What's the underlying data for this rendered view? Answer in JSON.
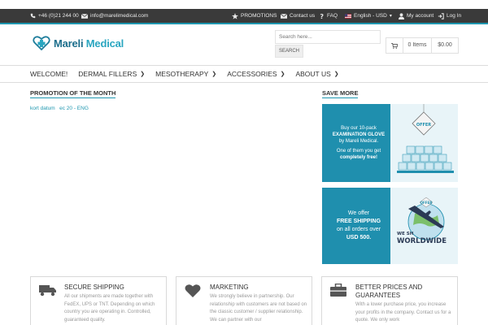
{
  "topbar": {
    "phone": "+46 (0)21 244 00",
    "email": "info@marelimedical.com",
    "promotions": "PROMOTIONS",
    "contact": "Contact us",
    "faq": "FAQ",
    "language": "English - USD",
    "account": "My account",
    "login": "Log In"
  },
  "header": {
    "brand_part1": "Mareli",
    "brand_part2": "Medical",
    "search_placeholder": "Search here...",
    "search_button": "SEARCH",
    "cart_items": "0 Items",
    "cart_total": "$0.00"
  },
  "nav": {
    "items": [
      {
        "label": "WELCOME!"
      },
      {
        "label": "DERMAL FILLERS"
      },
      {
        "label": "MESOTHERAPY"
      },
      {
        "label": "ACCESSORIES"
      },
      {
        "label": "ABOUT US"
      }
    ]
  },
  "promo": {
    "title": "PROMOTION OF THE MONTH",
    "link": "kort datum   ec 20 - ENG"
  },
  "savemore": {
    "title": "SAVE MORE",
    "banner1": {
      "line1": "Buy our 10-pack",
      "line2": "EXAMINATION GLOVE",
      "line3": "by Mareli Medical.",
      "line4": "One of them you get",
      "line5": "completely free!",
      "tag": "OFFER"
    },
    "banner2": {
      "line1": "We offer",
      "line2": "FREE SHIPPING",
      "line3": "on all orders over",
      "line4": "USD 500.",
      "art_word": "WORLDWIDE",
      "art_prefix": "WE SH",
      "tag": "OFFER"
    }
  },
  "features": [
    {
      "title": "SECURE SHIPPING",
      "text": "All our shipments are made together with FedEX, UPS or TNT. Depending on which country you are operating in. Controlled, guaranteed quality."
    },
    {
      "title": "MARKETING",
      "text": "We strongly believe in partnership. Our relationship with customers are not based on the classic customer / supplier relationship. We can partner with our"
    },
    {
      "title": "BETTER PRICES AND GUARANTEES",
      "text": "With a lower purchase price, you increase your profits in the company. Contact us for a quote. We only work"
    }
  ],
  "colors": {
    "accent": "#1f97b0",
    "topbar": "#3a3a3a",
    "banner": "#1f8fae"
  }
}
